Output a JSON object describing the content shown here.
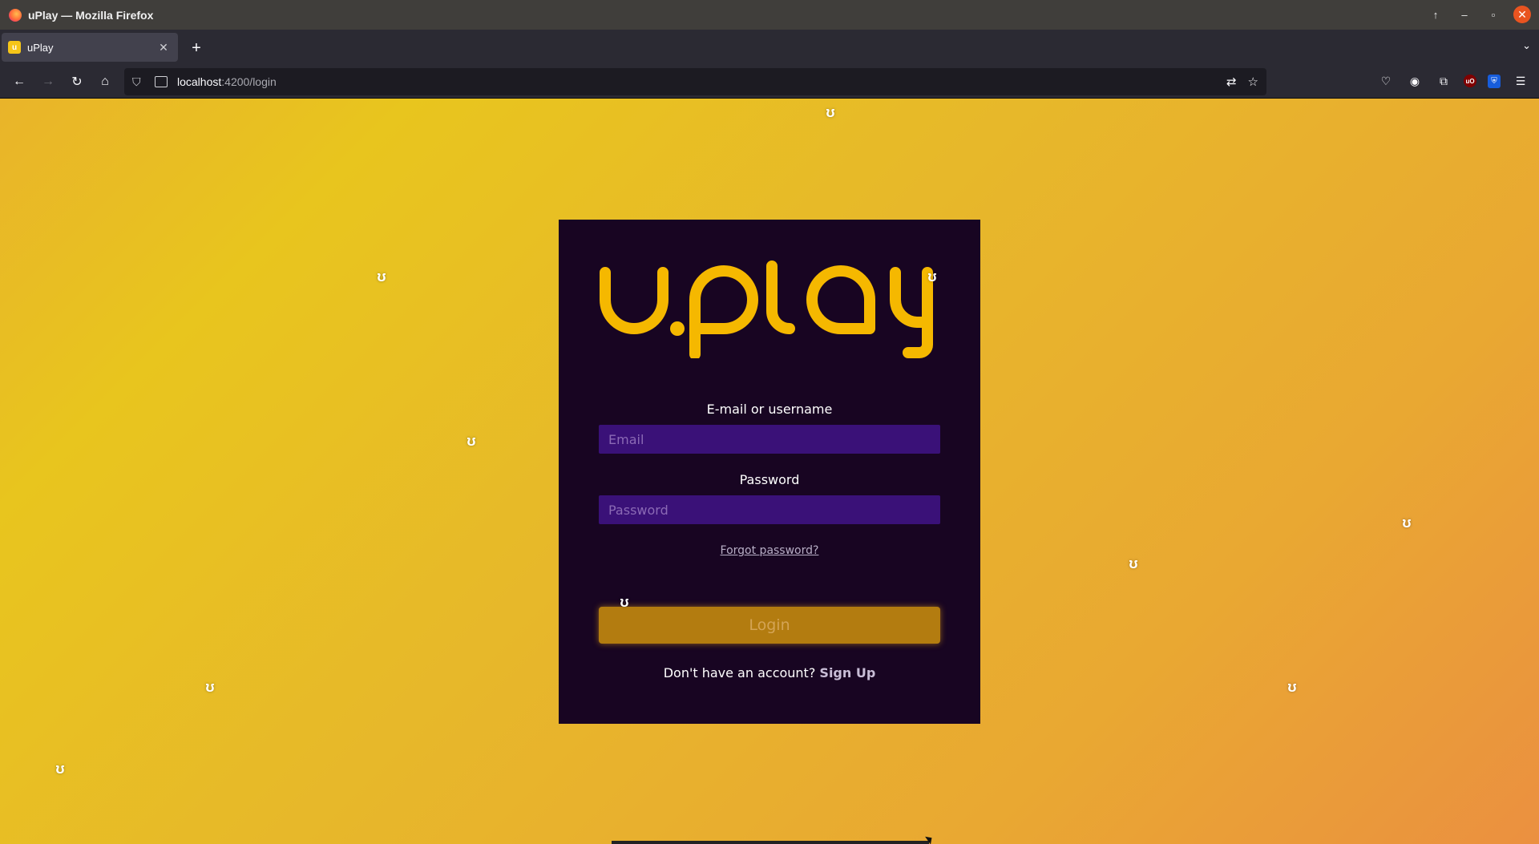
{
  "window": {
    "title": "uPlay — Mozilla Firefox"
  },
  "tabs": [
    {
      "label": "uPlay",
      "favicon": "uplay-favicon"
    }
  ],
  "navbar": {
    "url_host": "localhost",
    "url_path": ":4200/login"
  },
  "login_card": {
    "logo_text": "u.play",
    "email_label": "E-mail or username",
    "email_placeholder": "Email",
    "email_value": "",
    "password_label": "Password",
    "password_placeholder": "Password",
    "password_value": "",
    "forgot_link": "Forgot password?",
    "login_button": "Login",
    "signup_prompt": "Don't have an account?",
    "signup_link": "Sign Up"
  },
  "colors": {
    "card_bg": "#180522",
    "logo": "#f5b800",
    "input_bg": "#3a1178",
    "button_bg": "#b37c10",
    "page_gradient_start": "#e9b42a",
    "page_gradient_end": "#eb9040"
  },
  "decorations": {
    "floater_icon": "uplay-coin-icon",
    "floater_glyph": "ʊ"
  }
}
